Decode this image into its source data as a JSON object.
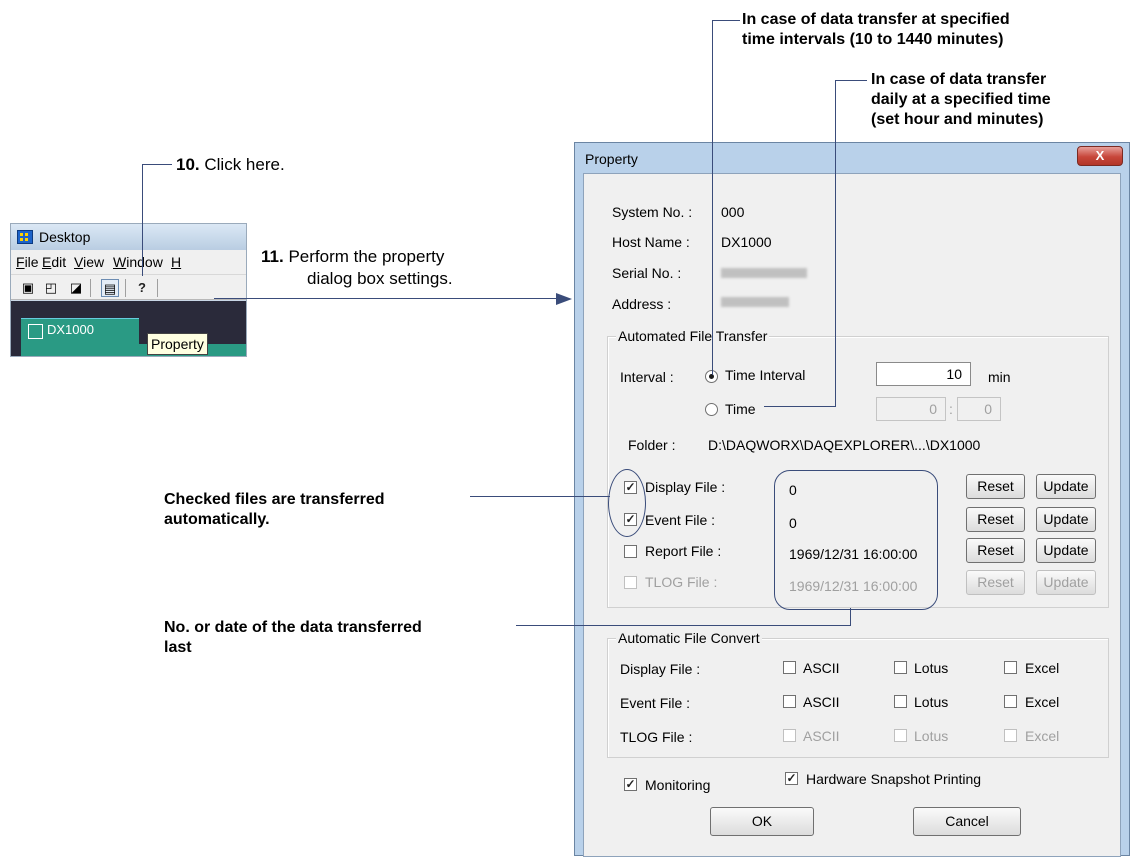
{
  "annotations": {
    "callout_interval": "In case of data transfer at specified time intervals (10 to 1440 minutes)",
    "callout_interval_l1": "In case of data transfer at specified",
    "callout_interval_l2": "time intervals (10 to 1440 minutes)",
    "callout_time_l1": "In case of data transfer",
    "callout_time_l2": "daily at a specified time",
    "callout_time_l3": "(set hour and minutes)",
    "step10_num": "10.",
    "step10_text": "Click here.",
    "step11_num": "11.",
    "step11_text_l1": "Perform the property",
    "step11_text_l2": "dialog box settings.",
    "checked_files_l1": "Checked files are transferred",
    "checked_files_l2": "automatically.",
    "last_data_l1": "No. or date of the data transferred",
    "last_data_l2": "last"
  },
  "desktop_app": {
    "title": "Desktop",
    "menu": [
      "File",
      "Edit",
      "View",
      "Window",
      "H"
    ],
    "tab_label": "DX1000",
    "tooltip": "Property"
  },
  "dialog": {
    "title": "Property",
    "close_label": "X",
    "system_no_label": "System No. :",
    "system_no_value": "000",
    "host_name_label": "Host Name :",
    "host_name_value": "DX1000",
    "serial_no_label": "Serial No. :",
    "address_label": "Address :",
    "auto_transfer": {
      "group_title": "Automated File Transfer",
      "interval_label": "Interval :",
      "time_interval_label": "Time Interval",
      "time_interval_value": "10",
      "min_unit": "min",
      "time_label": "Time",
      "time_hour": "0",
      "time_colon": ":",
      "time_minute": "0",
      "folder_label": "Folder :",
      "folder_value": "D:\\DAQWORX\\DAQEXPLORER\\...\\DX1000",
      "files": [
        {
          "label": "Display File :",
          "checked": true,
          "value": "0",
          "enabled": true
        },
        {
          "label": "Event File :",
          "checked": true,
          "value": "0",
          "enabled": true
        },
        {
          "label": "Report File :",
          "checked": false,
          "value": "1969/12/31 16:00:00",
          "enabled": true
        },
        {
          "label": "TLOG File :",
          "checked": false,
          "value": "1969/12/31 16:00:00",
          "enabled": false
        }
      ],
      "reset_label": "Reset",
      "update_label": "Update"
    },
    "auto_convert": {
      "group_title": "Automatic File Convert",
      "rows": [
        {
          "label": "Display File :",
          "enabled": true
        },
        {
          "label": "Event File :",
          "enabled": true
        },
        {
          "label": "TLOG File :",
          "enabled": false
        }
      ],
      "ascii_label": "ASCII",
      "lotus_label": "Lotus",
      "excel_label": "Excel"
    },
    "monitoring_label": "Monitoring",
    "monitoring_checked": true,
    "snapshot_label": "Hardware Snapshot Printing",
    "snapshot_checked": true,
    "ok_label": "OK",
    "cancel_label": "Cancel"
  }
}
